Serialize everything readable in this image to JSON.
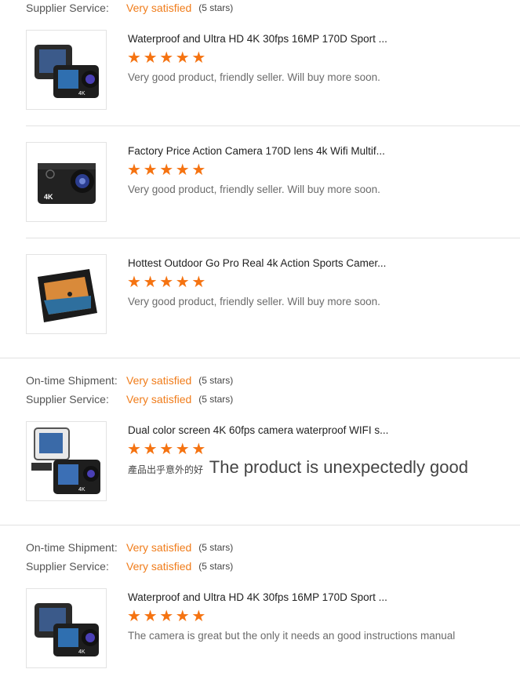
{
  "colors": {
    "accent": "#f07c1a",
    "star": "#f57311",
    "divider": "#e2e2e2"
  },
  "groups": [
    {
      "ratings": [
        {
          "label": "Supplier Service:",
          "value": "Very satisfied",
          "stars": "(5 stars)"
        }
      ],
      "items": [
        {
          "title": "Waterproof and Ultra HD 4K 30fps 16MP 170D Sport ...",
          "stars": 5,
          "review": "Very good product, friendly seller. Will buy more soon.",
          "thumb_icon": "dual-screen-action-camera"
        },
        {
          "title": "Factory Price Action Camera 170D lens 4k Wifi Multif...",
          "stars": 5,
          "review": "Very good product, friendly seller. Will buy more soon.",
          "thumb_icon": "action-camera-front"
        },
        {
          "title": "Hottest Outdoor Go Pro Real 4k Action Sports Camer...",
          "stars": 5,
          "review": "Very good product, friendly seller. Will buy more soon.",
          "thumb_icon": "action-camera-screen"
        }
      ]
    },
    {
      "ratings": [
        {
          "label": "On-time Shipment:",
          "value": "Very satisfied",
          "stars": "(5 stars)"
        },
        {
          "label": "Supplier Service:",
          "value": "Very satisfied",
          "stars": "(5 stars)"
        }
      ],
      "items": [
        {
          "title": "Dual color screen 4K 60fps camera waterproof WIFI s...",
          "stars": 5,
          "review_zh": "產品出乎意外的好",
          "review": "The product is unexpectedly good",
          "thumb_icon": "camera-with-accessories"
        }
      ]
    },
    {
      "ratings": [
        {
          "label": "On-time Shipment:",
          "value": "Very satisfied",
          "stars": "(5 stars)"
        },
        {
          "label": "Supplier Service:",
          "value": "Very satisfied",
          "stars": "(5 stars)"
        }
      ],
      "items": [
        {
          "title": "Waterproof and Ultra HD 4K 30fps 16MP 170D Sport ...",
          "stars": 5,
          "review": "The camera is great but the only it needs an good instructions manual",
          "thumb_icon": "dual-screen-action-camera"
        }
      ]
    }
  ]
}
